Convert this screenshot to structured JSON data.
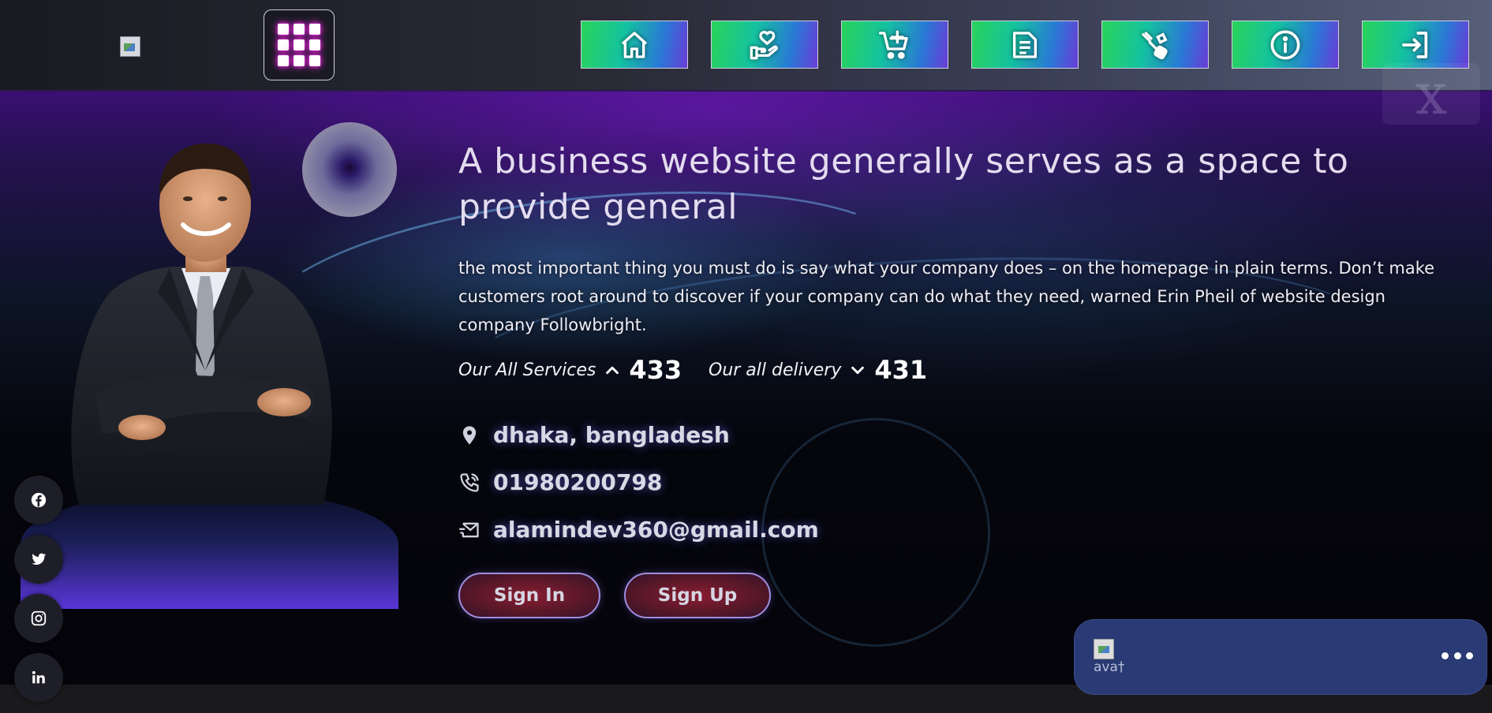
{
  "header": {
    "logo_icon": "broken-image-icon",
    "menu_icon": "grid-icon",
    "nav": [
      {
        "name": "home",
        "icon": "home-icon"
      },
      {
        "name": "donate",
        "icon": "hand-heart-icon"
      },
      {
        "name": "cart",
        "icon": "cart-plus-icon"
      },
      {
        "name": "blog",
        "icon": "document-icon"
      },
      {
        "name": "services",
        "icon": "tools-icon"
      },
      {
        "name": "about",
        "icon": "info-icon"
      },
      {
        "name": "login",
        "icon": "login-icon"
      }
    ],
    "corner_glyph": "x"
  },
  "hero": {
    "title": "A business website generally serves as a space to provide general",
    "description": "the most important thing you must do is say what your company does – on the homepage in plain terms. Don’t make customers root around to discover if your company can do what they need, warned Erin Pheil of website design company Followbright.",
    "stats": [
      {
        "label": "Our All Services",
        "value": "433",
        "arrow": "chevron-up-icon"
      },
      {
        "label": "Our all delivery",
        "value": "431",
        "arrow": "chevron-down-icon"
      }
    ],
    "contacts": {
      "location": "dhaka, bangladesh",
      "phone": "01980200798",
      "email": "alamindev360@gmail.com"
    },
    "buttons": {
      "sign_in": "Sign In",
      "sign_up": "Sign Up"
    }
  },
  "social": [
    "facebook-icon",
    "twitter-icon",
    "instagram-icon",
    "linkedin-icon"
  ],
  "chat": {
    "avatar_alt": "ava†",
    "more_icon": "more-horizontal-icon"
  },
  "colors": {
    "nav_gradient": [
      "#2ad35a",
      "#14c2a0",
      "#2a78d6",
      "#6a3cd6"
    ],
    "menu_glow": "#ff2cf0",
    "chat_bg": "#293a74",
    "button_bg": "#5a1828",
    "button_border": "#a08ee0"
  }
}
